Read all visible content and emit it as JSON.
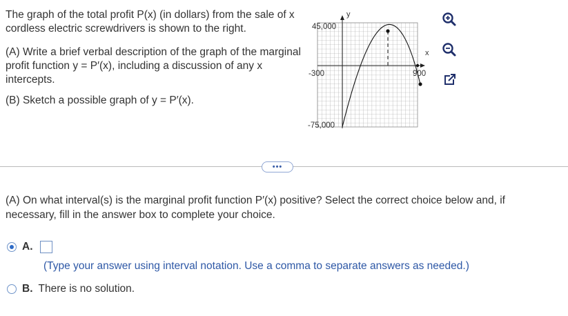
{
  "problem": {
    "intro": "The graph of the total profit P(x) (in dollars) from the sale of x cordless electric screwdrivers is shown to the right.",
    "part_a": "(A) Write a brief verbal description of the graph of the marginal profit function y = P′(x), including a discussion of any x intercepts.",
    "part_b": "(B) Sketch a possible graph of y = P′(x)."
  },
  "graph": {
    "y_axis_label": "y",
    "x_axis_label": "x",
    "y_max_label": "45,000",
    "y_min_label": "-75,000",
    "x_min_label": "-300",
    "x_max_label": "900"
  },
  "tools": {
    "zoom_in": "zoom-in-icon",
    "zoom_out": "zoom-out-icon",
    "popout": "external-link-icon"
  },
  "more_button_label": "•••",
  "question": {
    "text": "(A) On what interval(s) is the marginal profit function P′(x) positive? Select the correct choice below and, if necessary, fill in the answer box to complete your choice."
  },
  "choices": {
    "a_label": "A.",
    "a_hint": "(Type your answer using interval notation. Use a comma to separate answers as needed.)",
    "b_label": "B.",
    "b_text": "There is no solution."
  },
  "colors": {
    "accent": "#2e6bc7",
    "hint": "#2e58a6"
  }
}
